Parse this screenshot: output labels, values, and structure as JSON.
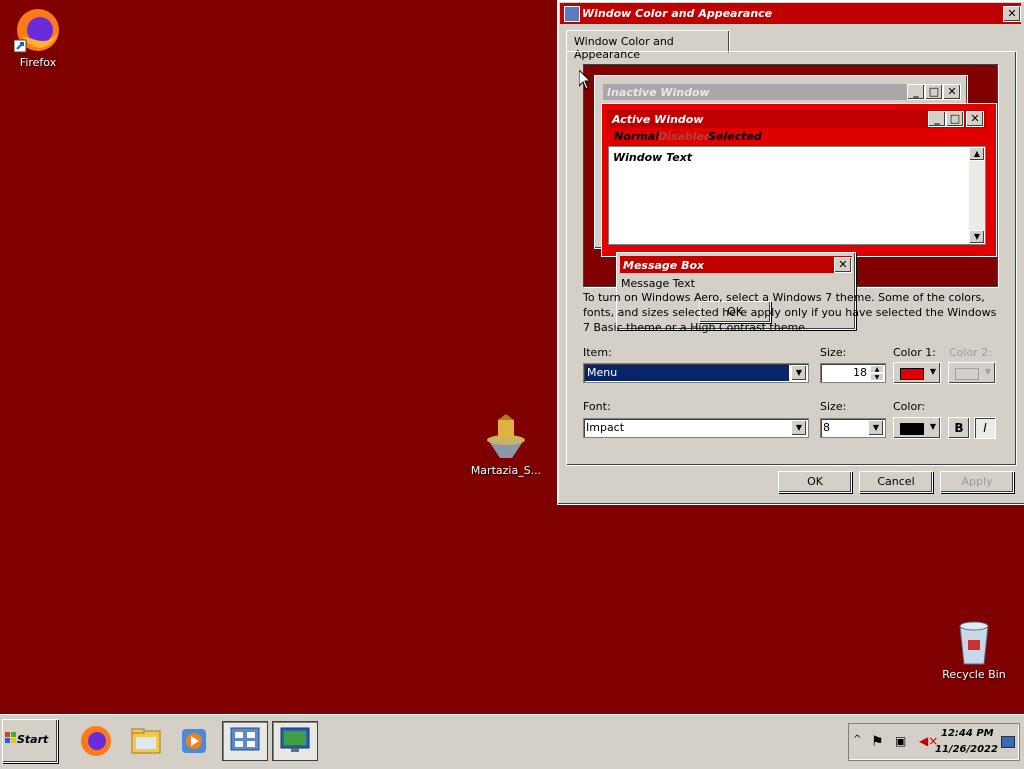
{
  "desktop": {
    "icons": [
      {
        "label": "Firefox"
      },
      {
        "label": "Martazia_S..."
      },
      {
        "label": "Recycle Bin"
      }
    ],
    "background_color": "#800000"
  },
  "dialog": {
    "title": "Window Color and Appearance",
    "close_glyph": "✕",
    "tab_label": "Window Color and Appearance",
    "preview": {
      "inactive_title": "Inactive Window",
      "active_title": "Active Window",
      "menu_normal": "Normal",
      "menu_disabled": "Disabled",
      "menu_selected": "Selected",
      "window_text": "Window Text",
      "msgbox_title": "Message Box",
      "msgbox_text": "Message Text",
      "msgbox_ok": "OK"
    },
    "info_text": "To turn on Windows Aero, select a Windows 7 theme.  Some of the colors, fonts, and sizes selected here apply only if you have selected the Windows 7 Basic theme or a High Contrast theme.",
    "item_label": "Item:",
    "item_value": "Menu",
    "size_label": "Size:",
    "size_value": "18",
    "color1_label": "Color 1:",
    "color1_value": "#e00000",
    "color2_label": "Color 2:",
    "font_label": "Font:",
    "font_value": "Impact",
    "font_size_label": "Size:",
    "font_size_value": "8",
    "font_color_label": "Color:",
    "font_color_value": "#000000",
    "bold_label": "B",
    "italic_label": "I",
    "ok_label": "OK",
    "cancel_label": "Cancel",
    "apply_label": "Apply"
  },
  "taskbar": {
    "start_label": "Start",
    "apps": [
      {
        "icon": "firefox-icon"
      },
      {
        "icon": "file-explorer-icon"
      },
      {
        "icon": "media-player-icon"
      },
      {
        "icon": "control-panel-icon"
      },
      {
        "icon": "display-settings-icon"
      }
    ],
    "clock_time": "12:44 PM",
    "clock_date": "11/26/2022"
  }
}
